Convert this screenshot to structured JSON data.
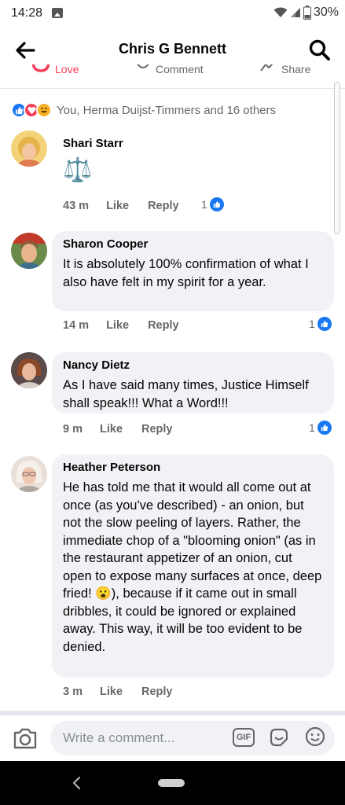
{
  "status_bar": {
    "time": "14:28",
    "battery": "30%"
  },
  "header": {
    "title": "Chris G Bennett"
  },
  "action_bar": {
    "love": "Love",
    "comment": "Comment",
    "share": "Share"
  },
  "reactions": {
    "summary": "You, Herma Duijst-Timmers and 16 others"
  },
  "comments": [
    {
      "name": "Shari Starr",
      "body": "⚖️",
      "time": "43 m",
      "like": "Like",
      "reply": "Reply",
      "likes": "1"
    },
    {
      "name": "Sharon Cooper",
      "body": "It is absolutely 100% confirmation of what I also have felt in my spirit for a year.",
      "time": "14 m",
      "like": "Like",
      "reply": "Reply",
      "likes": "1"
    },
    {
      "name": "Nancy Dietz",
      "body": "As I have said many times, Justice Himself shall speak!!! What a Word!!!",
      "time": "9 m",
      "like": "Like",
      "reply": "Reply",
      "likes": "1"
    },
    {
      "name": "Heather Peterson",
      "body": "He has told me that it would all come out at once (as you've described) - an onion, but not the slow peeling of layers. Rather, the immediate chop of a \"blooming onion\" (as in the restaurant appetizer of an onion, cut open to expose many surfaces at once, deep fried! 😮), because if it came out in small dribbles, it could be ignored or explained away. This way, it will be too evident to be denied.",
      "time": "3 m",
      "like": "Like",
      "reply": "Reply"
    }
  ],
  "composer": {
    "placeholder": "Write a comment...",
    "gif_label": "GIF"
  },
  "colors": {
    "accent": "#1877f2",
    "love": "#f33e58",
    "bubble": "#f0f2f5",
    "secondary_text": "#65676b"
  }
}
